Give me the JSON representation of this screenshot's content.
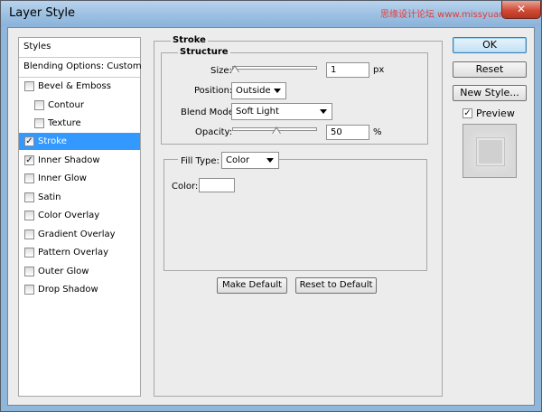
{
  "window": {
    "title": "Layer Style",
    "watermark": "思缘设计论坛 www.missyuan.com",
    "close_glyph": "✕"
  },
  "styles_list": {
    "header": "Styles",
    "blending": "Blending Options: Custom",
    "items": [
      {
        "label": "Bevel & Emboss",
        "checked": false
      },
      {
        "label": "Contour",
        "checked": false,
        "sub": true
      },
      {
        "label": "Texture",
        "checked": false,
        "sub": true
      },
      {
        "label": "Stroke",
        "checked": true,
        "selected": true
      },
      {
        "label": "Inner Shadow",
        "checked": true
      },
      {
        "label": "Inner Glow",
        "checked": false
      },
      {
        "label": "Satin",
        "checked": false
      },
      {
        "label": "Color Overlay",
        "checked": false
      },
      {
        "label": "Gradient Overlay",
        "checked": false
      },
      {
        "label": "Pattern Overlay",
        "checked": false
      },
      {
        "label": "Outer Glow",
        "checked": false
      },
      {
        "label": "Drop Shadow",
        "checked": false
      }
    ],
    "check_glyph": "✓"
  },
  "stroke": {
    "title": "Stroke",
    "structure_title": "Structure",
    "size": {
      "label": "Size:",
      "value": "1",
      "unit": "px",
      "level": 0.0
    },
    "position": {
      "label": "Position:",
      "value": "Outside"
    },
    "blend_mode": {
      "label": "Blend Mode:",
      "value": "Soft Light"
    },
    "opacity": {
      "label": "Opacity:",
      "value": "50",
      "unit": "%",
      "level": 0.5
    },
    "fill": {
      "label": "Fill Type:",
      "value": "Color",
      "color_label": "Color:",
      "color": "#ffffff"
    },
    "make_default": "Make Default",
    "reset_default": "Reset to Default"
  },
  "right_buttons": {
    "ok": "OK",
    "reset": "Reset",
    "new_style": "New Style...",
    "preview_label": "Preview",
    "preview_checked": true
  },
  "colors": {
    "selection": "#3399ff",
    "title_bar": "#9cc0e2",
    "dialog_bg": "#ececec"
  }
}
